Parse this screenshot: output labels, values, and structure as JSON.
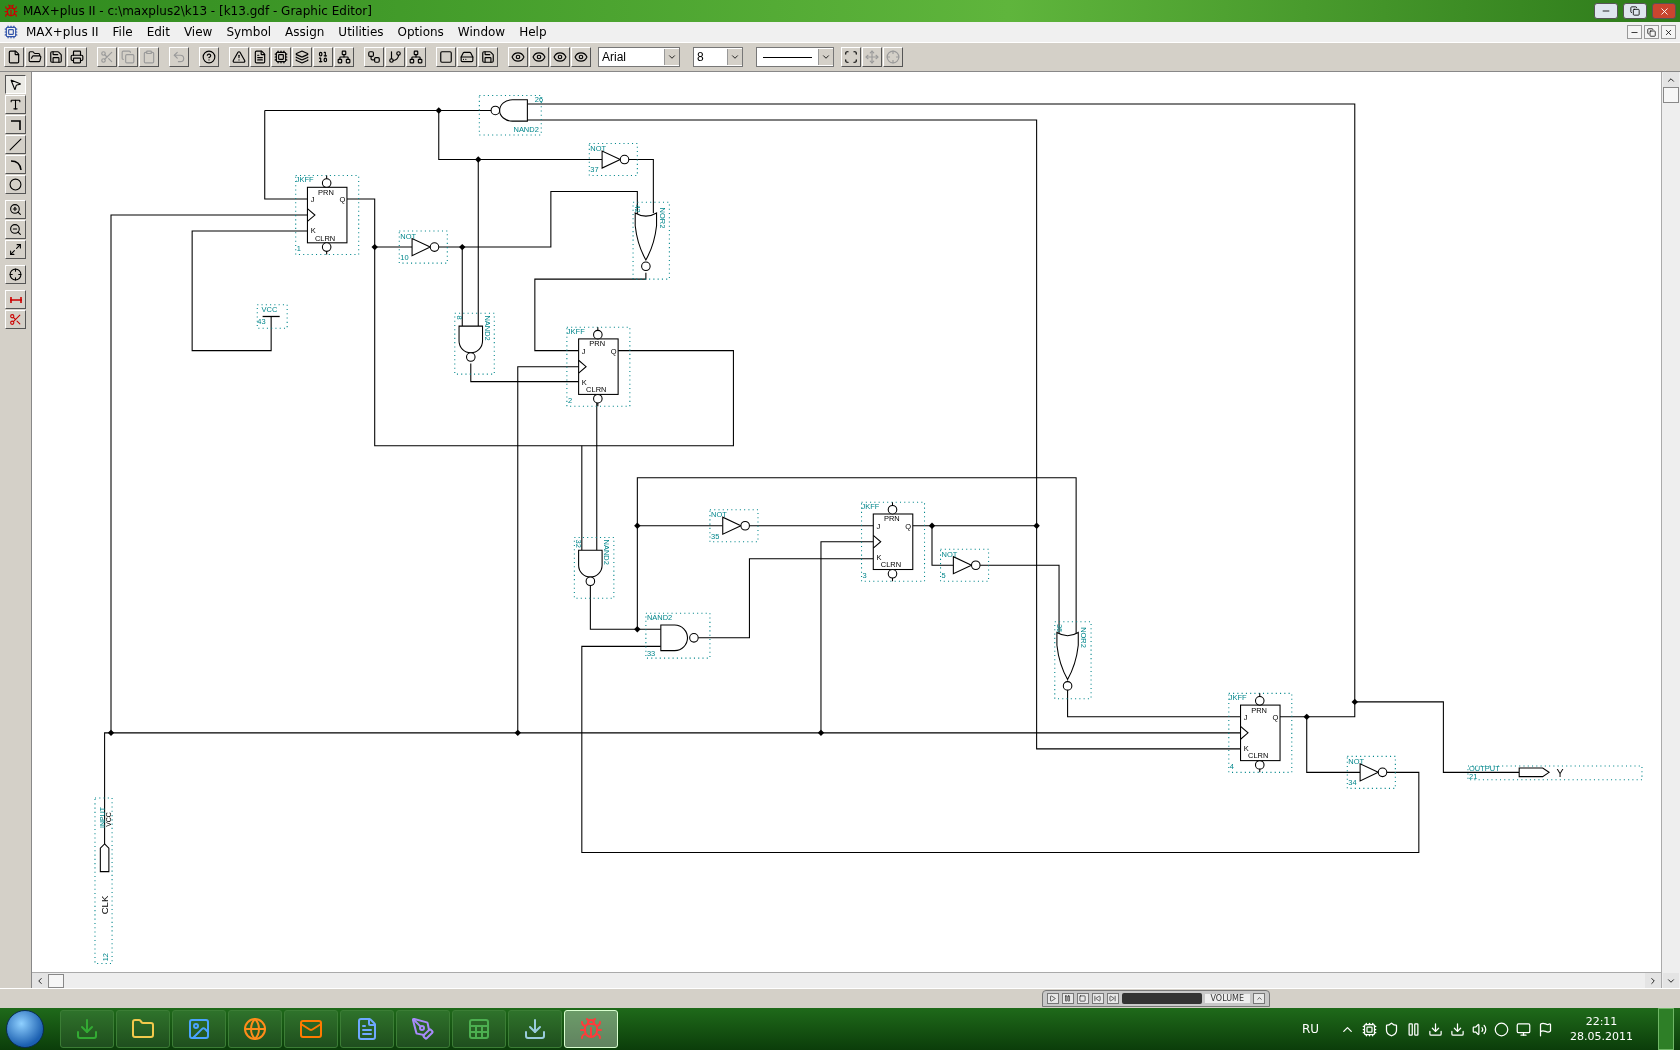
{
  "window": {
    "title": "MAX+plus II - c:\\maxplus2\\k13 - [k13.gdf - Graphic Editor]"
  },
  "menu": [
    {
      "label": "MAX+plus II"
    },
    {
      "label": "File"
    },
    {
      "label": "Edit"
    },
    {
      "label": "View"
    },
    {
      "label": "Symbol"
    },
    {
      "label": "Assign"
    },
    {
      "label": "Utilities"
    },
    {
      "label": "Options"
    },
    {
      "label": "Window"
    },
    {
      "label": "Help"
    }
  ],
  "toolbar": {
    "buttons": [
      {
        "disabled": false
      },
      {
        "disabled": false
      },
      {
        "disabled": false
      },
      {
        "disabled": false
      },
      {
        "disabled": true
      },
      {
        "disabled": true
      },
      {
        "disabled": true
      },
      {
        "disabled": true
      },
      {
        "disabled": false
      },
      {
        "disabled": false
      },
      {
        "disabled": false
      },
      {
        "disabled": false
      },
      {
        "disabled": false
      },
      {
        "disabled": false
      },
      {
        "disabled": false
      },
      {
        "disabled": false
      },
      {
        "disabled": false
      },
      {
        "disabled": false
      },
      {
        "disabled": false
      },
      {
        "disabled": false
      },
      {
        "disabled": false
      },
      {
        "disabled": false
      },
      {
        "disabled": false
      },
      {
        "disabled": false
      },
      {
        "disabled": false
      }
    ],
    "font": "Arial",
    "size": "8",
    "end_buttons": [
      {
        "disabled": false
      },
      {
        "disabled": true
      },
      {
        "disabled": true
      }
    ]
  },
  "palette": [
    {
      "selected": true
    },
    {
      "selected": false
    },
    {
      "selected": false
    },
    {
      "selected": false
    },
    {
      "selected": false
    },
    {
      "selected": false
    },
    {
      "selected": false
    },
    {
      "selected": false
    },
    {
      "selected": false
    },
    {
      "selected": false
    },
    {
      "selected": false
    },
    {
      "selected": false
    }
  ],
  "schematic": {
    "components": [
      {
        "kind": "jkff",
        "title": "JKFF",
        "number": "1",
        "pins": [
          "PRN",
          "J",
          "Q",
          "K",
          "CLRN"
        ]
      },
      {
        "kind": "jkff",
        "title": "JKFF",
        "number": "2",
        "pins": [
          "PRN",
          "J",
          "Q",
          "K",
          "CLRN"
        ]
      },
      {
        "kind": "jkff",
        "title": "JKFF",
        "number": "3",
        "pins": [
          "PRN",
          "J",
          "Q",
          "K",
          "CLRN"
        ]
      },
      {
        "kind": "jkff",
        "title": "JKFF",
        "number": "4",
        "pins": [
          "PRN",
          "J",
          "Q",
          "K",
          "CLRN"
        ]
      },
      {
        "kind": "nandleft",
        "title": "NAND2",
        "number": "26"
      },
      {
        "kind": "not",
        "title": "NOT",
        "number": "37"
      },
      {
        "kind": "nordown",
        "title": "NOR2",
        "number": "42"
      },
      {
        "kind": "not",
        "title": "NOT",
        "number": "10"
      },
      {
        "kind": "nanddown",
        "title": "NAND2",
        "number": "8"
      },
      {
        "kind": "vcc",
        "title": "VCC",
        "number": "43"
      },
      {
        "kind": "nanddown",
        "title": "NAND2",
        "number": "32"
      },
      {
        "kind": "not",
        "title": "NOT",
        "number": "35"
      },
      {
        "kind": "nandright",
        "title": "NAND2",
        "number": "33"
      },
      {
        "kind": "not",
        "title": "NOT",
        "number": "5"
      },
      {
        "kind": "nordown",
        "title": "NOR2",
        "number": "36"
      },
      {
        "kind": "not",
        "title": "NOT",
        "number": "34"
      },
      {
        "kind": "output",
        "title": "OUTPUT",
        "number": "21",
        "name": "Y"
      },
      {
        "kind": "input",
        "title": "INPUT",
        "default": "VCC",
        "name": "CLK",
        "number": "12"
      }
    ]
  },
  "media_player": {
    "volume_label": "VOLUME"
  },
  "taskbar": {
    "apps": [
      {
        "selected": false
      },
      {
        "selected": false
      },
      {
        "selected": false
      },
      {
        "selected": false
      },
      {
        "selected": false
      },
      {
        "selected": false
      },
      {
        "selected": false
      },
      {
        "selected": false
      },
      {
        "selected": false
      },
      {
        "selected": true
      }
    ],
    "language": "RU",
    "time": "22:11",
    "date": "28.05.2011"
  }
}
